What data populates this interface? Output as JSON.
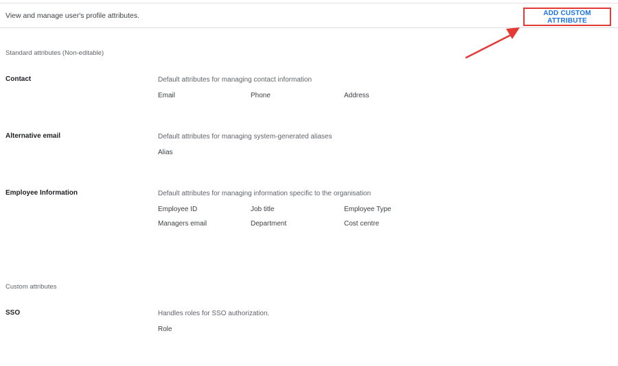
{
  "header": {
    "description": "View and manage user's profile attributes.",
    "add_button_label": "ADD CUSTOM ATTRIBUTE"
  },
  "standard_section": {
    "title": "Standard attributes (Non-editable)",
    "groups": [
      {
        "name": "Contact",
        "description": "Default attributes for managing contact information",
        "attributes": [
          "Email",
          "Phone",
          "Address"
        ]
      },
      {
        "name": "Alternative email",
        "description": "Default attributes for managing system-generated aliases",
        "attributes": [
          "Alias"
        ]
      },
      {
        "name": "Employee Information",
        "description": "Default attributes for managing information specific to the organisation",
        "attributes": [
          "Employee ID",
          "Job title",
          "Employee Type",
          "Managers email",
          "Department",
          "Cost centre"
        ]
      }
    ]
  },
  "custom_section": {
    "title": "Custom attributes",
    "groups": [
      {
        "name": "SSO",
        "description": "Handles roles for SSO authorization.",
        "attributes": [
          "Role"
        ]
      }
    ]
  },
  "colors": {
    "accent_blue": "#1a73e8",
    "highlight_red": "#e53935"
  },
  "annotations": {
    "arrow_icon": "red-arrow-icon",
    "highlight_box": "red-highlight-box"
  }
}
